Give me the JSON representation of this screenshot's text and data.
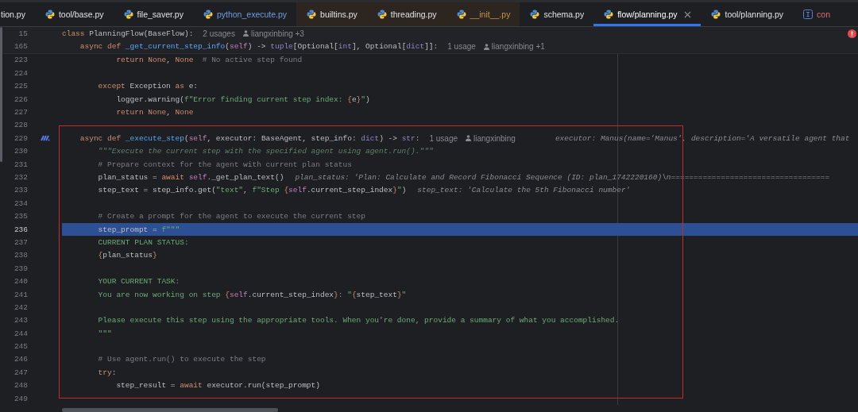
{
  "tabs": [
    {
      "label": "tion.py",
      "kind": "normal",
      "selected": false
    },
    {
      "label": "tool/base.py",
      "kind": "normal",
      "selected": false
    },
    {
      "label": "file_saver.py",
      "kind": "normal",
      "selected": false
    },
    {
      "label": "python_execute.py",
      "kind": "modified",
      "selected": false
    },
    {
      "label": "builtins.py",
      "kind": "library",
      "selected": false
    },
    {
      "label": "threading.py",
      "kind": "library",
      "selected": false
    },
    {
      "label": "__init__.py",
      "kind": "library_modified",
      "selected": false
    },
    {
      "label": "schema.py",
      "kind": "normal",
      "selected": false
    },
    {
      "label": "flow/planning.py",
      "kind": "normal",
      "selected": true
    },
    {
      "label": "tool/planning.py",
      "kind": "normal",
      "selected": false
    },
    {
      "label": "con",
      "kind": "error",
      "selected": false
    }
  ],
  "sticky_lines": [
    {
      "number": "15",
      "segments": [
        {
          "kind": "kw",
          "text": "class "
        },
        {
          "kind": "plain",
          "text": "PlanningFlow(BaseFlow):"
        },
        {
          "kind": "meta",
          "text": "2 usages"
        },
        {
          "kind": "author",
          "text": "liangxinbing +3"
        }
      ]
    },
    {
      "number": "165",
      "segments": [
        {
          "kind": "kw",
          "text": "    async def "
        },
        {
          "kind": "func",
          "text": "_get_current_step_info"
        },
        {
          "kind": "plain",
          "text": "("
        },
        {
          "kind": "self",
          "text": "self"
        },
        {
          "kind": "plain",
          "text": ") -> "
        },
        {
          "kind": "builtin",
          "text": "tuple"
        },
        {
          "kind": "plain",
          "text": "[Optional["
        },
        {
          "kind": "builtin",
          "text": "int"
        },
        {
          "kind": "plain",
          "text": "], Optional["
        },
        {
          "kind": "builtin",
          "text": "dict"
        },
        {
          "kind": "plain",
          "text": "]]:"
        },
        {
          "kind": "meta",
          "text": "1 usage"
        },
        {
          "kind": "author",
          "text": "liangxinbing +1"
        }
      ]
    }
  ],
  "blocks": [
    {
      "boxed": false,
      "lines": [
        {
          "number": "223",
          "selected": false,
          "segments": [
            {
              "kind": "kw",
              "text": "            return None"
            },
            {
              "kind": "plain",
              "text": ", "
            },
            {
              "kind": "kw",
              "text": "None"
            },
            {
              "kind": "comment",
              "text": "  # No active step found"
            }
          ]
        },
        {
          "number": "224",
          "selected": false
        },
        {
          "number": "225",
          "selected": false,
          "segments": [
            {
              "kind": "kw",
              "text": "        except "
            },
            {
              "kind": "plain",
              "text": "Exception "
            },
            {
              "kind": "kw",
              "text": "as "
            },
            {
              "kind": "plain",
              "text": "e:"
            }
          ]
        },
        {
          "number": "226",
          "selected": false,
          "segments": [
            {
              "kind": "plain",
              "text": "            logger.warning("
            },
            {
              "kind": "string",
              "text": "f\"Error finding current step index: "
            },
            {
              "kind": "brace",
              "text": "{"
            },
            {
              "kind": "plain",
              "text": "e"
            },
            {
              "kind": "brace",
              "text": "}"
            },
            {
              "kind": "string",
              "text": "\""
            },
            {
              "kind": "plain",
              "text": ")"
            }
          ]
        },
        {
          "number": "227",
          "selected": false,
          "segments": [
            {
              "kind": "kw",
              "text": "            return None"
            },
            {
              "kind": "plain",
              "text": ", "
            },
            {
              "kind": "kw",
              "text": "None"
            }
          ]
        }
      ]
    },
    {
      "boxed": true,
      "lines": [
        {
          "number": "228",
          "selected": false
        },
        {
          "number": "229",
          "selected": false,
          "ai_marked": true,
          "segments": [
            {
              "kind": "kw",
              "text": "    async def "
            },
            {
              "kind": "func",
              "text": "_execute_step"
            },
            {
              "kind": "plain",
              "text": "("
            },
            {
              "kind": "self",
              "text": "self"
            },
            {
              "kind": "plain",
              "text": ", executor: BaseAgent, step_info: "
            },
            {
              "kind": "builtin",
              "text": "dict"
            },
            {
              "kind": "plain",
              "text": ") -> "
            },
            {
              "kind": "builtin",
              "text": "str"
            },
            {
              "kind": "plain",
              "text": ":"
            },
            {
              "kind": "meta",
              "text": "1 usage"
            },
            {
              "kind": "author",
              "text": "liangxinbing"
            },
            {
              "kind": "debug_far",
              "text": "executor: Manus(name='Manus', description='A versatile agent that"
            }
          ]
        },
        {
          "number": "230",
          "selected": false,
          "segments": [
            {
              "kind": "docstring",
              "text": "        \"\"\"Execute the current step with the specified agent using agent.run().\"\"\""
            }
          ]
        },
        {
          "number": "231",
          "selected": false,
          "segments": [
            {
              "kind": "comment",
              "text": "        # Prepare context for the agent with current plan status"
            }
          ]
        },
        {
          "number": "232",
          "selected": false,
          "segments": [
            {
              "kind": "plain",
              "text": "        plan_status = "
            },
            {
              "kind": "kw",
              "text": "await "
            },
            {
              "kind": "self",
              "text": "self"
            },
            {
              "kind": "plain",
              "text": "._get_plan_text()"
            },
            {
              "kind": "debug",
              "text": "plan_status: 'Plan: Calculate and Record Fibonacci Sequence (ID: plan_1742220160)\\n==================================="
            }
          ]
        },
        {
          "number": "233",
          "selected": false,
          "segments": [
            {
              "kind": "plain",
              "text": "        step_text = step_info.get("
            },
            {
              "kind": "string",
              "text": "\"text\""
            },
            {
              "kind": "plain",
              "text": ", "
            },
            {
              "kind": "string",
              "text": "f\"Step "
            },
            {
              "kind": "brace",
              "text": "{"
            },
            {
              "kind": "self",
              "text": "self"
            },
            {
              "kind": "plain",
              "text": ".current_step_index"
            },
            {
              "kind": "brace",
              "text": "}"
            },
            {
              "kind": "string",
              "text": "\""
            },
            {
              "kind": "plain",
              "text": ")"
            },
            {
              "kind": "debug",
              "text": "step_text: 'Calculate the 5th Fibonacci number'"
            }
          ]
        },
        {
          "number": "234",
          "selected": false
        },
        {
          "number": "235",
          "selected": false,
          "segments": [
            {
              "kind": "comment",
              "text": "        # Create a prompt for the agent to execute the current step"
            }
          ]
        },
        {
          "number": "236",
          "selected": true,
          "segments": [
            {
              "kind": "plain",
              "text": "        step_prompt = "
            },
            {
              "kind": "string",
              "text": "f\"\"\""
            }
          ]
        },
        {
          "number": "237",
          "selected": false,
          "segments": [
            {
              "kind": "string",
              "text": "        CURRENT PLAN STATUS:"
            }
          ]
        },
        {
          "number": "238",
          "selected": false,
          "segments": [
            {
              "kind": "brace",
              "text": "        {"
            },
            {
              "kind": "plain",
              "text": "plan_status"
            },
            {
              "kind": "brace",
              "text": "}"
            }
          ]
        },
        {
          "number": "239",
          "selected": false
        },
        {
          "number": "240",
          "selected": false,
          "segments": [
            {
              "kind": "string",
              "text": "        YOUR CURRENT TASK:"
            }
          ]
        },
        {
          "number": "241",
          "selected": false,
          "segments": [
            {
              "kind": "string",
              "text": "        You are now working on step "
            },
            {
              "kind": "brace",
              "text": "{"
            },
            {
              "kind": "self",
              "text": "self"
            },
            {
              "kind": "plain",
              "text": ".current_step_index"
            },
            {
              "kind": "brace",
              "text": "}"
            },
            {
              "kind": "string",
              "text": ": \""
            },
            {
              "kind": "brace",
              "text": "{"
            },
            {
              "kind": "plain",
              "text": "step_text"
            },
            {
              "kind": "brace",
              "text": "}"
            },
            {
              "kind": "string",
              "text": "\""
            }
          ]
        },
        {
          "number": "242",
          "selected": false
        },
        {
          "number": "243",
          "selected": false,
          "segments": [
            {
              "kind": "string",
              "text": "        Please execute this step using the appropriate tools. When you're done, provide a summary of what you accomplished."
            }
          ]
        },
        {
          "number": "244",
          "selected": false,
          "segments": [
            {
              "kind": "string",
              "text": "        \"\"\""
            }
          ]
        },
        {
          "number": "245",
          "selected": false
        },
        {
          "number": "246",
          "selected": false,
          "segments": [
            {
              "kind": "comment",
              "text": "        # Use agent.run() to execute the step"
            }
          ]
        },
        {
          "number": "247",
          "selected": false,
          "segments": [
            {
              "kind": "kw",
              "text": "        try"
            },
            {
              "kind": "plain",
              "text": ":"
            }
          ]
        },
        {
          "number": "248",
          "selected": false,
          "segments": [
            {
              "kind": "plain",
              "text": "            step_result = "
            },
            {
              "kind": "kw",
              "text": "await "
            },
            {
              "kind": "plain",
              "text": "executor.run(step_prompt)"
            }
          ]
        },
        {
          "number": "249",
          "selected": false
        }
      ]
    }
  ]
}
